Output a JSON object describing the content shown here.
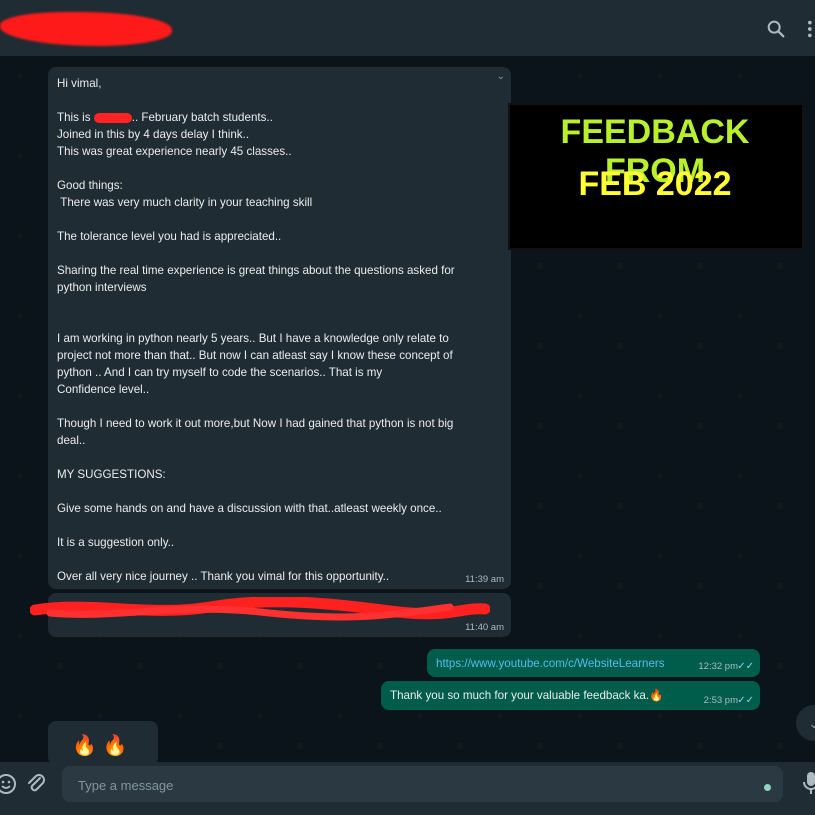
{
  "header": {
    "search_icon": "search-icon",
    "menu_icon": "more-vertical-icon"
  },
  "message_main": {
    "text": "Hi vimal,\n\nThis is ■■■■■.. February batch students..\nJoined in this by 4 days delay I think..\nThis was great experience nearly 45 classes..\n\nGood things:\n There was very much clarity in your teaching skill\n\nThe tolerance level you had is appreciated..\n\nSharing the real time experience is great things about the questions asked for\npython interviews\n\n\nI am working in python nearly 5 years.. But I have a knowledge only relate to\nproject not more than that.. But now I can atleast say I know these concept of\npython .. And I can try myself to code the scenarios.. That is my\nConfidence level..\n\nThough I need to work it out more,but Now I had gained that python is not big\ndeal..\n\nMY SUGGESTIONS:\n\nGive some hands on and have a discussion with that..atleast weekly once..\n\nIt is a suggestion only..\n\nOver all very nice journey .. Thank you vimal for this opportunity..",
    "time": "11:39 am"
  },
  "message_redacted": {
    "time": "11:40 am"
  },
  "overlay": {
    "line1": "FEEDBACK FROM",
    "line2": "FEB 2022"
  },
  "out_messages": [
    {
      "text": "https://www.youtube.com/c/WebsiteLearners",
      "time": "12:32 pm",
      "status": "✓✓"
    },
    {
      "text": "Thank you so much for your valuable feedback ka.🔥",
      "time": "2:53 pm",
      "status": "✓✓"
    }
  ],
  "emoji_message": {
    "text": "🔥 🔥"
  },
  "composer": {
    "placeholder": "Type a message"
  },
  "colors": {
    "incoming": "#202c33",
    "outgoing": "#005c4b",
    "background": "#0b141a",
    "panel": "#1f2c33"
  }
}
